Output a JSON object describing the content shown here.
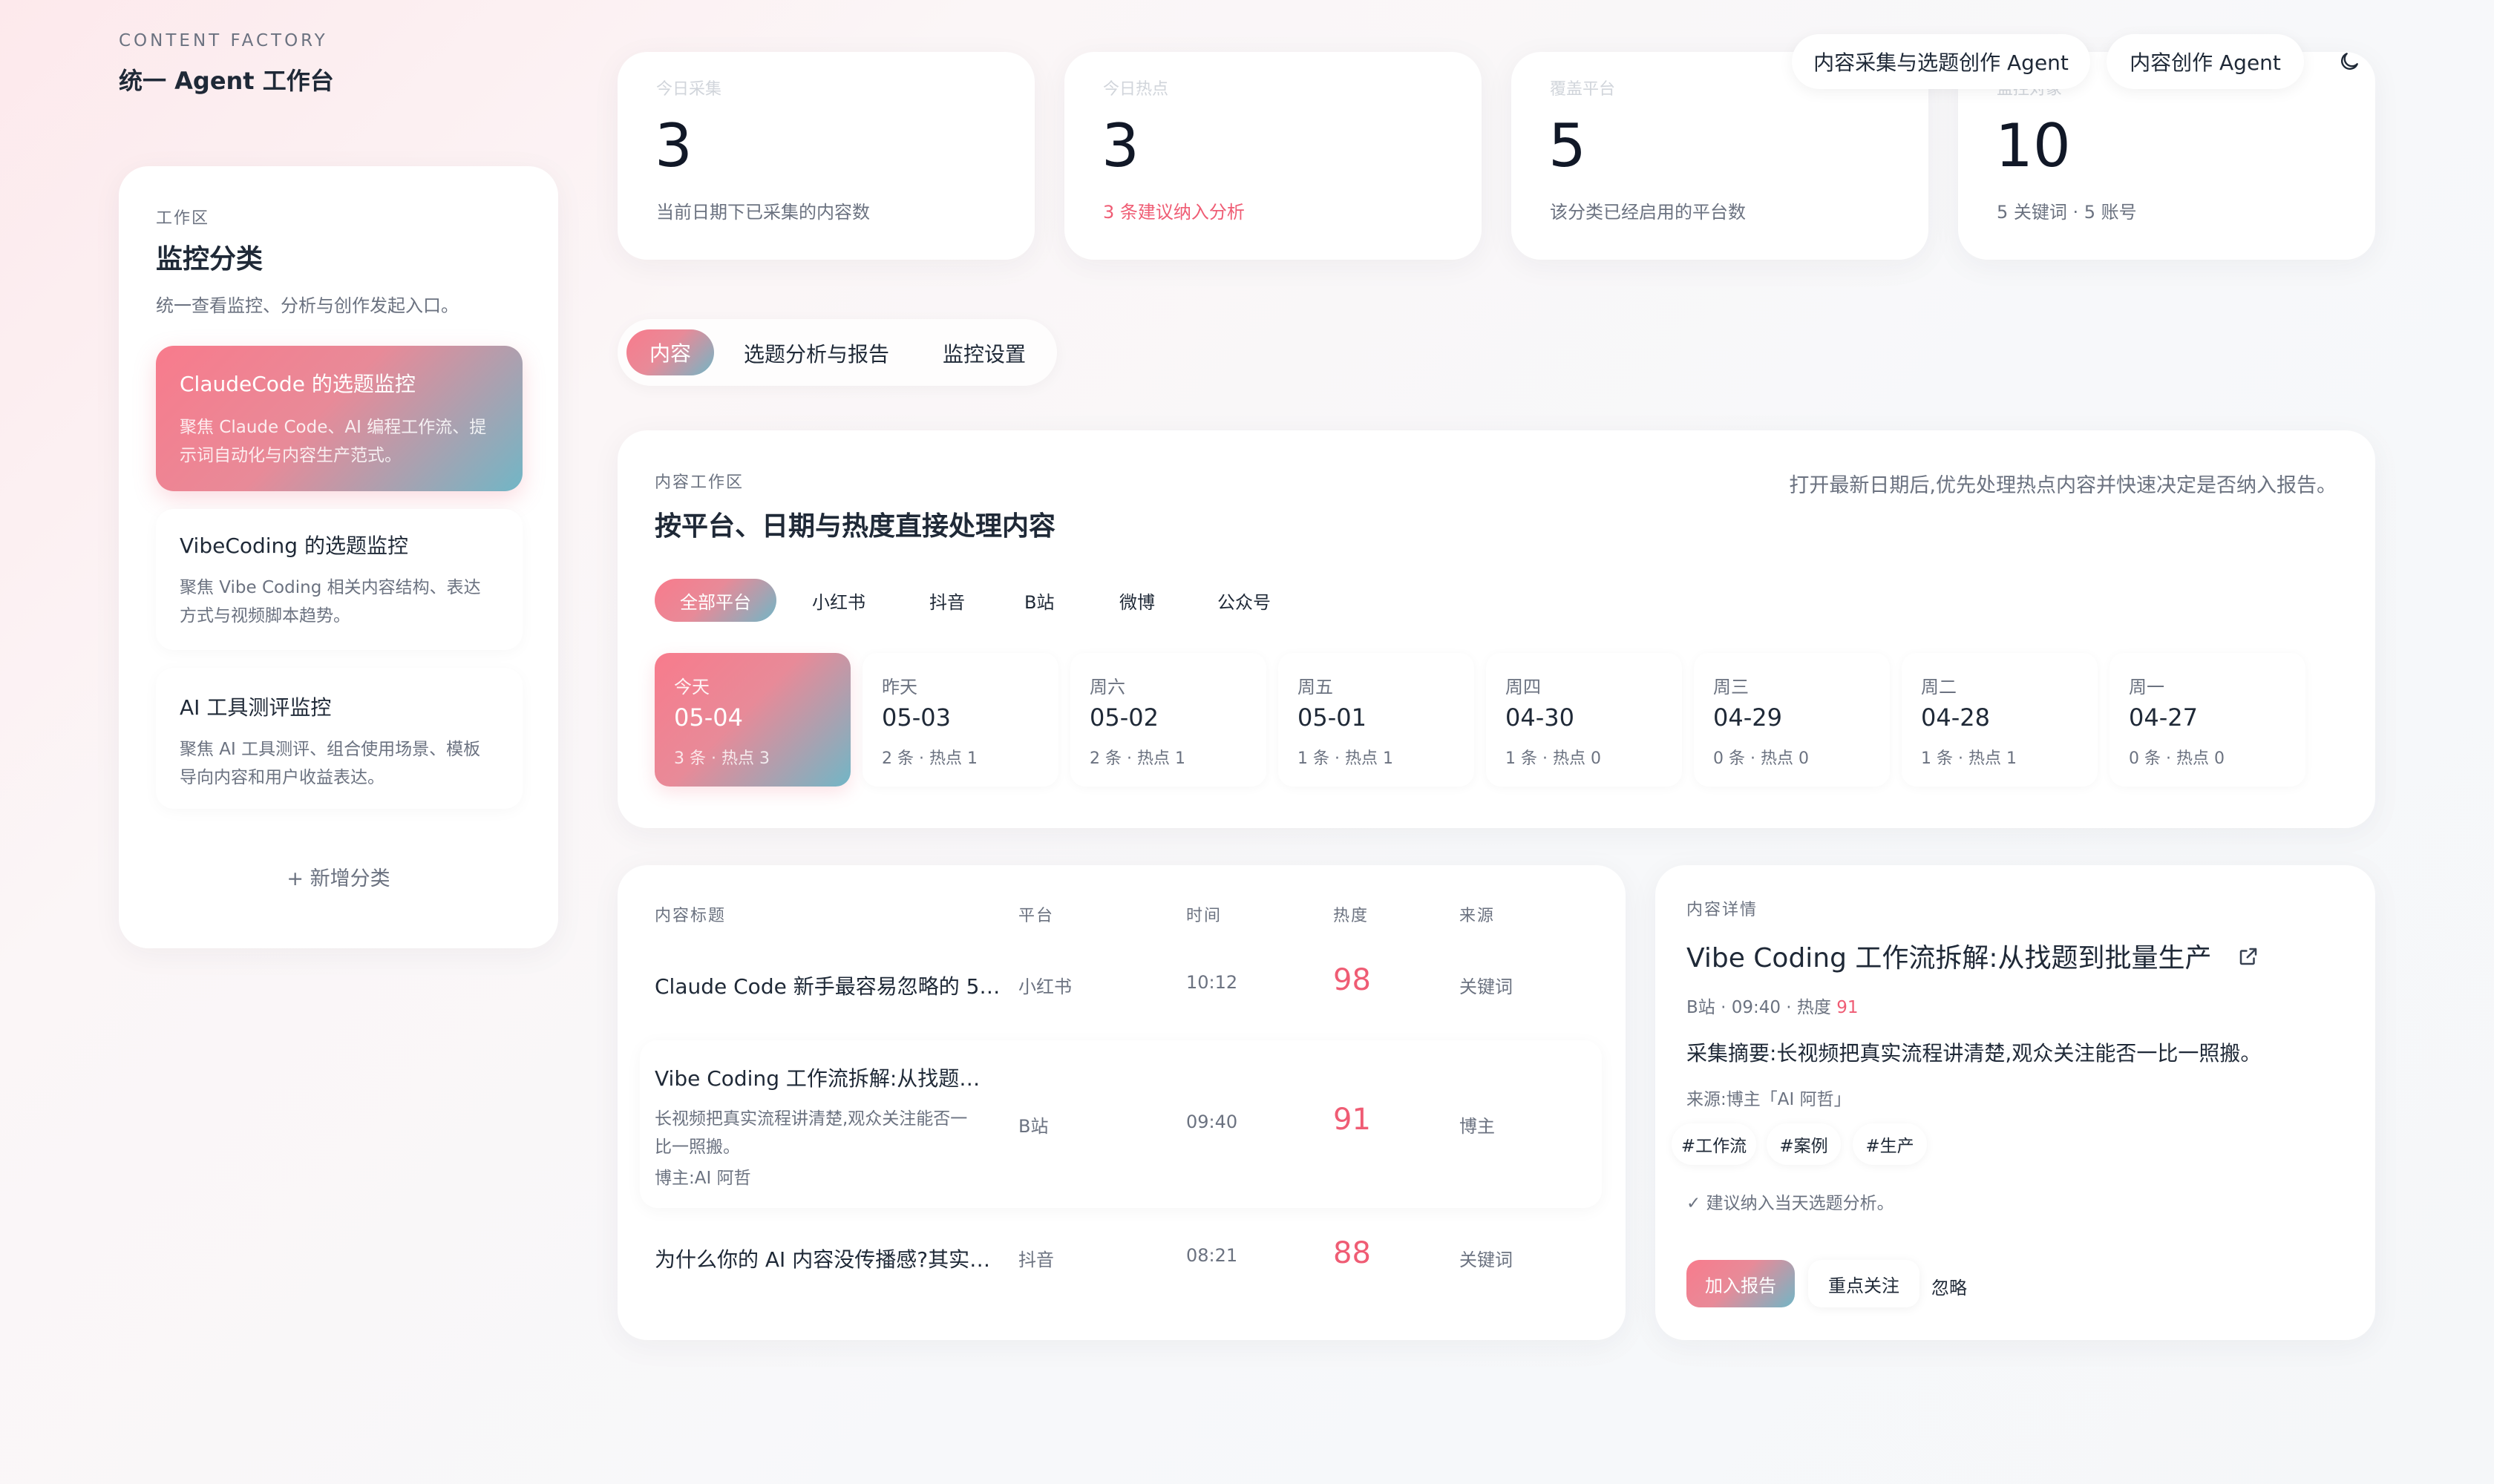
{
  "brand": {
    "subtitle": "CONTENT FACTORY",
    "title": "统一 Agent 工作台"
  },
  "header": {
    "agent1": "内容采集与选题创作 Agent",
    "agent2": "内容创作 Agent",
    "theme_icon": "moon-icon"
  },
  "sidebar": {
    "section": "工作区",
    "title": "监控分类",
    "desc": "统一查看监控、分析与创作发起入口。",
    "items": [
      {
        "title": "ClaudeCode 的选题监控",
        "desc1": "聚焦 Claude Code、AI 编程工作流、提",
        "desc2": "示词自动化与内容生产范式。"
      },
      {
        "title": "VibeCoding 的选题监控",
        "desc1": "聚焦 Vibe Coding 相关内容结构、表达",
        "desc2": "方式与视频脚本趋势。"
      },
      {
        "title": "AI 工具测评监控",
        "desc1": "聚焦 AI 工具测评、组合使用场景、模板",
        "desc2": "导向内容和用户收益表达。"
      }
    ],
    "add": "+ 新增分类"
  },
  "stats": [
    {
      "label": "今日采集",
      "value": "3",
      "note": "当前日期下已采集的内容数"
    },
    {
      "label": "今日热点",
      "value": "3",
      "note": "3 条建议纳入分析"
    },
    {
      "label": "覆盖平台",
      "value": "5",
      "note": "该分类已经启用的平台数"
    },
    {
      "label": "监控对象",
      "value": "10",
      "note": "5 关键词 · 5 账号"
    }
  ],
  "tabs": [
    "内容",
    "选题分析与报告",
    "监控设置"
  ],
  "workspace": {
    "section": "内容工作区",
    "title": "按平台、日期与热度直接处理内容",
    "hint": "打开最新日期后,优先处理热点内容并快速决定是否纳入报告。",
    "platforms": [
      "全部平台",
      "小红书",
      "抖音",
      "B站",
      "微博",
      "公众号"
    ],
    "dates": [
      {
        "day": "今天",
        "date": "05-04",
        "meta": "3 条 · 热点 3"
      },
      {
        "day": "昨天",
        "date": "05-03",
        "meta": "2 条 · 热点 1"
      },
      {
        "day": "周六",
        "date": "05-02",
        "meta": "2 条 · 热点 1"
      },
      {
        "day": "周五",
        "date": "05-01",
        "meta": "1 条 · 热点 1"
      },
      {
        "day": "周四",
        "date": "04-30",
        "meta": "1 条 · 热点 0"
      },
      {
        "day": "周三",
        "date": "04-29",
        "meta": "0 条 · 热点 0"
      },
      {
        "day": "周二",
        "date": "04-28",
        "meta": "1 条 · 热点 1"
      },
      {
        "day": "周一",
        "date": "04-27",
        "meta": "0 条 · 热点 0"
      }
    ]
  },
  "table": {
    "headers": [
      "内容标题",
      "平台",
      "时间",
      "热度",
      "来源"
    ],
    "rows": [
      {
        "title": "Claude Code 新手最容易忽略的 5…",
        "platform": "小红书",
        "time": "10:12",
        "heat": "98",
        "source": "关键词"
      },
      {
        "title": "Vibe Coding 工作流拆解:从找题…",
        "desc1": "长视频把真实流程讲清楚,观众关注能否一",
        "desc2": "比一照搬。",
        "author": "博主:AI 阿哲",
        "platform": "B站",
        "time": "09:40",
        "heat": "91",
        "source": "博主"
      },
      {
        "title": "为什么你的 AI 内容没传播感?其实…",
        "platform": "抖音",
        "time": "08:21",
        "heat": "88",
        "source": "关键词"
      }
    ]
  },
  "detail": {
    "section": "内容详情",
    "title": "Vibe Coding 工作流拆解:从找题到批量生产",
    "meta_prefix": "B站 · 09:40 · 热度 ",
    "meta_heat": "91",
    "summary": "采集摘要:长视频把真实流程讲清楚,观众关注能否一比一照搬。",
    "source": "来源:博主「AI 阿哲」",
    "tags": [
      "#工作流",
      "#案例",
      "#生产"
    ],
    "suggest": "✓ 建议纳入当天选题分析。",
    "actions": [
      "加入报告",
      "重点关注",
      "忽略"
    ]
  }
}
